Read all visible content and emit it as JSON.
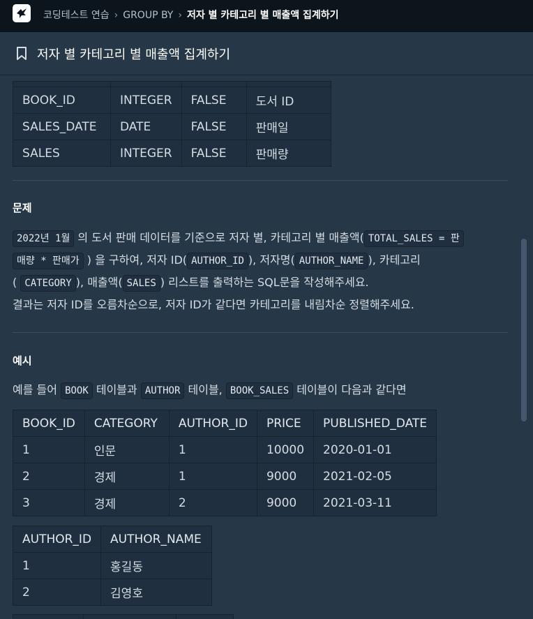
{
  "breadcrumb": {
    "item1": "코딩테스트 연습",
    "item2": "GROUP BY",
    "current": "저자 별 카테고리 별 매출액 집계하기"
  },
  "page": {
    "title": "저자 별 카테고리 별 매출액 집계하기"
  },
  "schema_rows": [
    [
      "BOOK_ID",
      "INTEGER",
      "FALSE",
      "도서 ID"
    ],
    [
      "SALES_DATE",
      "DATE",
      "FALSE",
      "판매일"
    ],
    [
      "SALES",
      "INTEGER",
      "FALSE",
      "판매량"
    ]
  ],
  "problem": {
    "heading": "문제",
    "l1_code1": "2022년 1월",
    "l1_t1": " 의 도서 판매 데이터를 기준으로 저자 별, 카테고리 별 매출액(",
    "l1_code2": "TOTAL_SALES = 판",
    "l2_code1": "매량 * 판매가",
    "l2_t1": ") 을 구하여, 저자 ID(",
    "l2_code2": "AUTHOR_ID",
    "l2_t2": "), 저자명(",
    "l2_code3": "AUTHOR_NAME",
    "l2_t3": "), 카테고리",
    "l3_t0": "(",
    "l3_code1": "CATEGORY",
    "l3_t1": "), 매출액(",
    "l3_code2": "SALES",
    "l3_t2": ") 리스트를 출력하는 SQL문을 작성해주세요.",
    "l4": "결과는 저자 ID를 오름차순으로, 저자 ID가 같다면 카테고리를 내림차순 정렬해주세요."
  },
  "example": {
    "heading": "예시",
    "t0": "예를 들어 ",
    "code1": "BOOK",
    "t1": " 테이블과 ",
    "code2": "AUTHOR",
    "t2": " 테이블, ",
    "code3": "BOOK_SALES",
    "t3": " 테이블이 다음과 같다면"
  },
  "book_table": {
    "headers": [
      "BOOK_ID",
      "CATEGORY",
      "AUTHOR_ID",
      "PRICE",
      "PUBLISHED_DATE"
    ],
    "rows": [
      [
        "1",
        "인문",
        "1",
        "10000",
        "2020-01-01"
      ],
      [
        "2",
        "경제",
        "1",
        "9000",
        "2021-02-05"
      ],
      [
        "3",
        "경제",
        "2",
        "9000",
        "2021-03-11"
      ]
    ]
  },
  "author_table": {
    "headers": [
      "AUTHOR_ID",
      "AUTHOR_NAME"
    ],
    "rows": [
      [
        "1",
        "홍길동"
      ],
      [
        "2",
        "김영호"
      ]
    ]
  }
}
